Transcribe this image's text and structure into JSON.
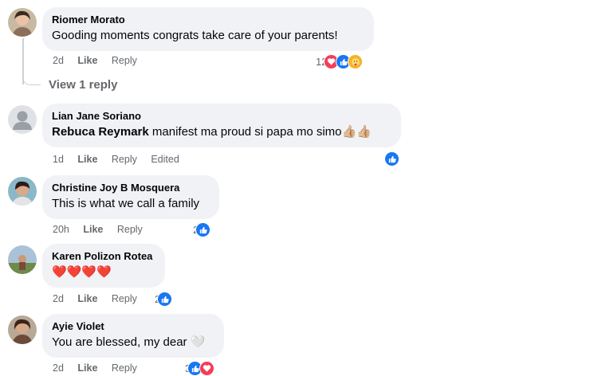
{
  "comments": [
    {
      "author": "Riomer Morato",
      "text": "Gooding moments congrats take care of your parents!",
      "time": "2d",
      "like": "Like",
      "reply": "Reply",
      "reaction_count": "12",
      "reactions": [
        "love-icon",
        "like-icon",
        "care-icon"
      ]
    },
    {
      "author": "Lian Jane Soriano",
      "mention": "Rebuca Reymark",
      "text": " manifest ma proud si papa mo simo👍🏼👍🏼",
      "time": "1d",
      "like": "Like",
      "reply": "Reply",
      "edited": "Edited",
      "reactions": [
        "like-icon"
      ]
    },
    {
      "author": "Christine Joy B Mosquera",
      "text": "This is what we call a family",
      "time": "20h",
      "like": "Like",
      "reply": "Reply",
      "reaction_count": "2",
      "reactions": [
        "like-icon"
      ]
    },
    {
      "author": "Karen Polizon Rotea",
      "text": "❤️❤️❤️❤️",
      "time": "2d",
      "like": "Like",
      "reply": "Reply",
      "reaction_count": "2",
      "reactions": [
        "like-icon"
      ]
    },
    {
      "author": "Ayie Violet",
      "text": "You are blessed, my dear 🤍",
      "time": "2d",
      "like": "Like",
      "reply": "Reply",
      "reaction_count": "3",
      "reactions": [
        "like-icon",
        "love-icon"
      ]
    }
  ],
  "view_replies": "View 1 reply",
  "colors": {
    "like": "#1877f2",
    "love": "#f33e58",
    "care": "#f7b125",
    "bubble": "#f0f2f5",
    "meta": "#65676b"
  }
}
